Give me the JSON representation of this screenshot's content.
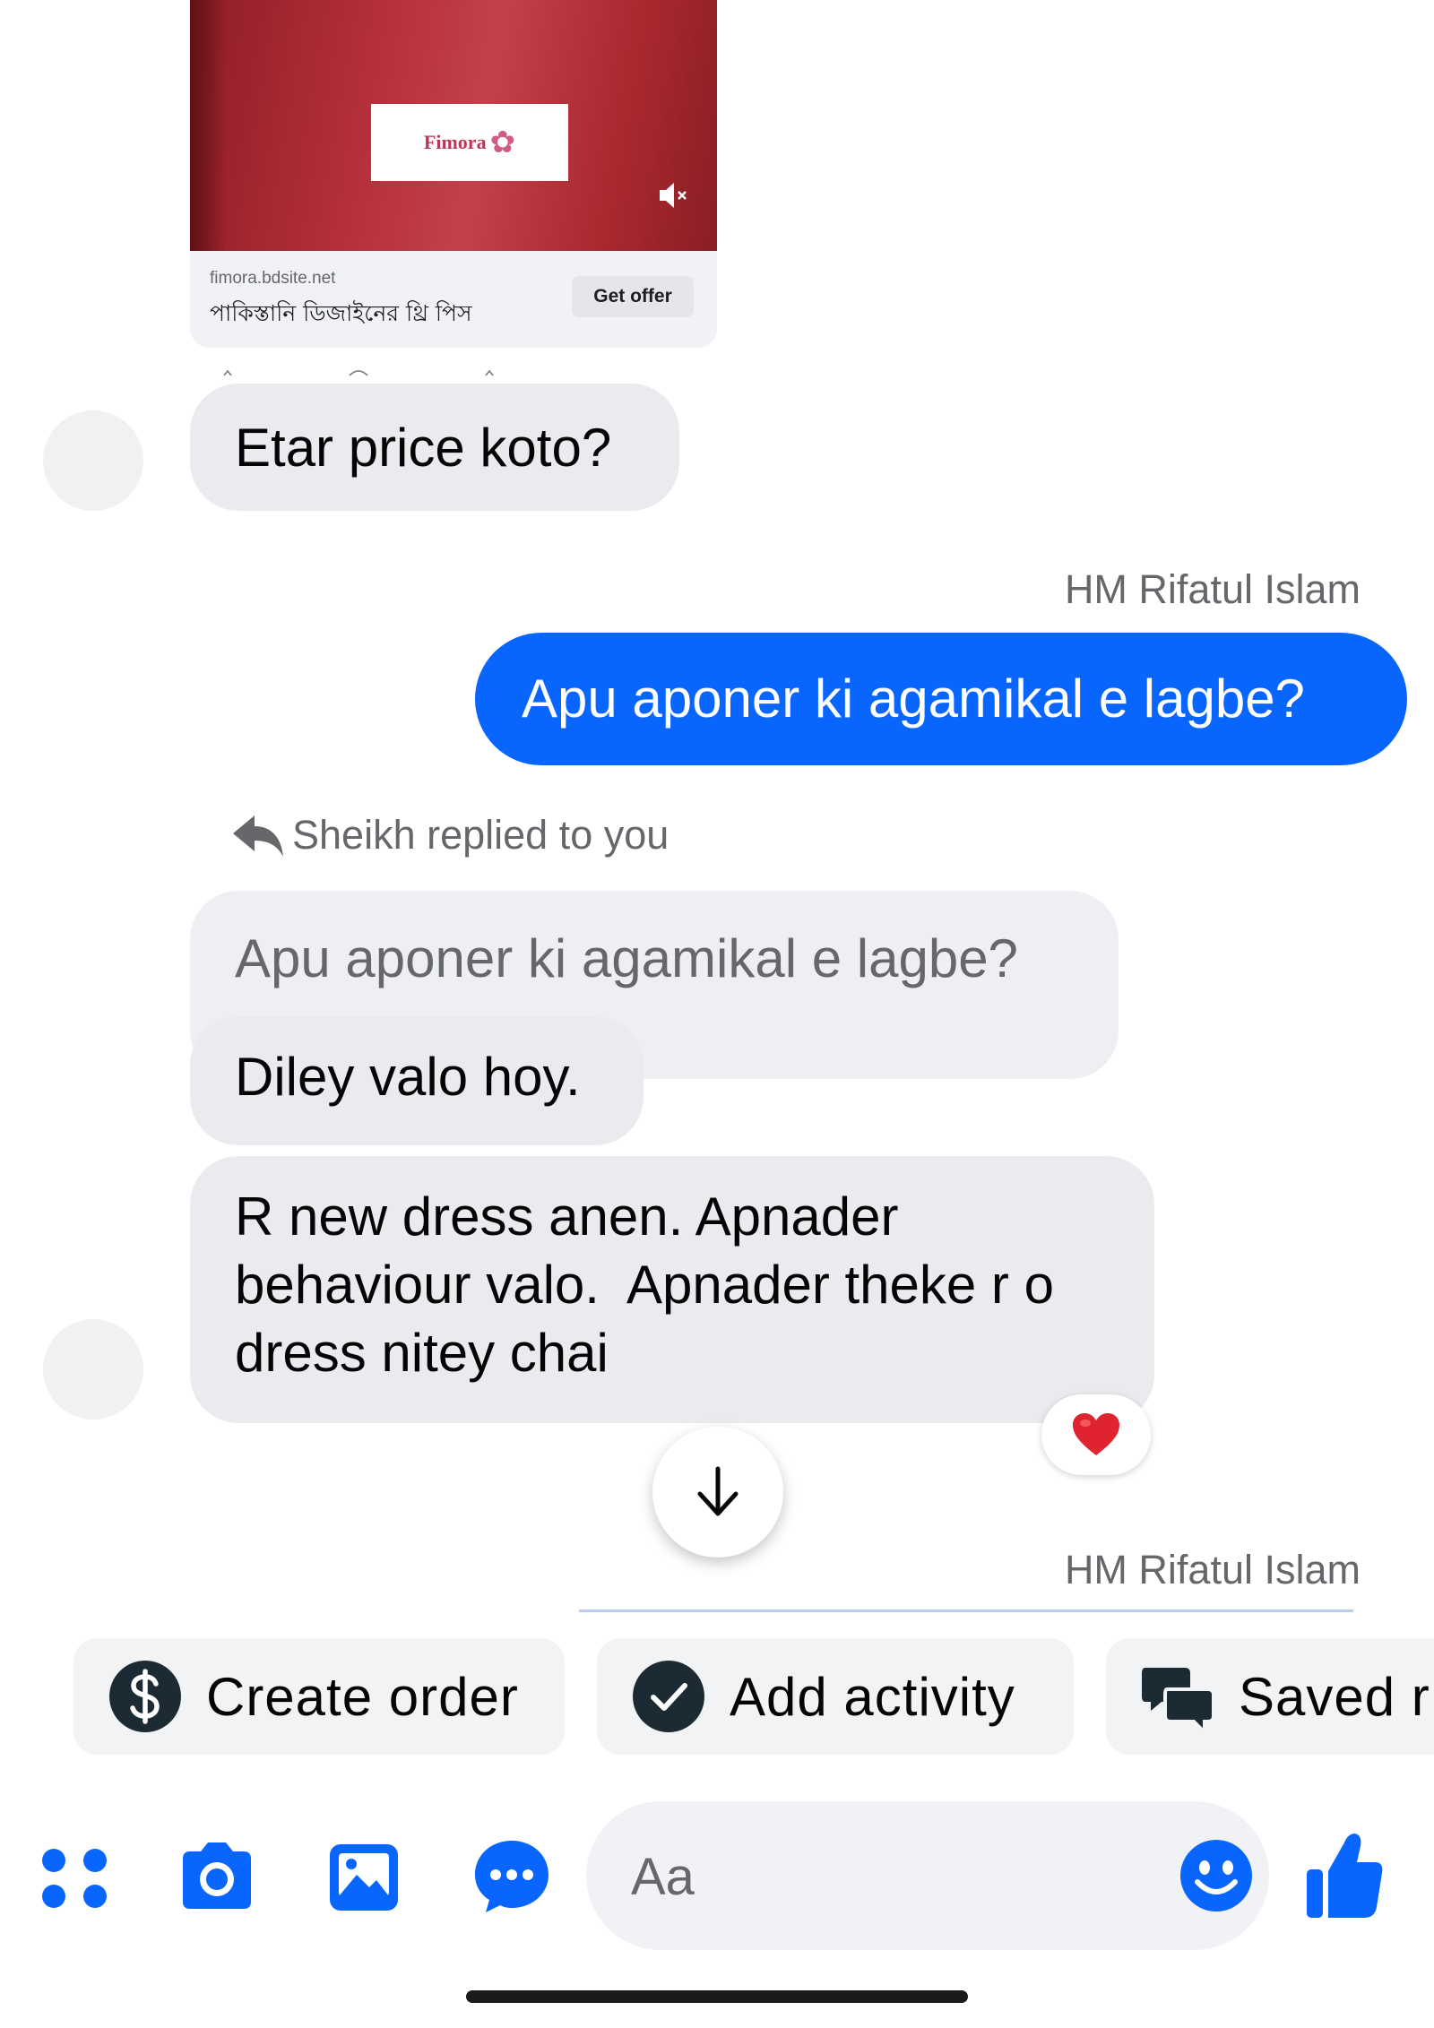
{
  "ad": {
    "brand_logo_text": "Fimora",
    "domain": "fimora.bdsite.net",
    "headline": "পাকিস্তানি ডিজাইনের থ্রি পিস",
    "cta_label": "Get offer"
  },
  "messages": [
    {
      "direction": "incoming",
      "text": "Etar price koto?"
    },
    {
      "direction": "outgoing",
      "sender": "HM Rifatul Islam",
      "text": "Apu aponer ki agamikal e lagbe?"
    },
    {
      "direction": "incoming",
      "reply_header": "Sheikh replied to you",
      "quoted": "Apu aponer ki agamikal e lagbe?",
      "text": "Diley valo hoy."
    },
    {
      "direction": "incoming",
      "lines": [
        "R new dress anen. Apnader",
        "behaviour valo.  Apnader theke r o",
        "dress nitey chai"
      ],
      "reaction": "heart"
    }
  ],
  "next_sender": "HM Rifatul Islam",
  "quick_actions": [
    {
      "label": "Create order",
      "icon": "dollar-circle-icon"
    },
    {
      "label": "Add activity",
      "icon": "check-circle-icon"
    },
    {
      "label": "Saved r",
      "icon": "chat-bubbles-icon"
    }
  ],
  "composer": {
    "placeholder": "Aa",
    "tools": [
      "apps-grid-icon",
      "camera-icon",
      "photo-icon",
      "chat-dots-icon"
    ],
    "emoji_icon": "smiley-icon",
    "send_icon": "thumbs-up-icon"
  },
  "colors": {
    "accent": "#0866ff",
    "incoming_bubble": "#e9ebef",
    "reaction_heart": "#e0242f"
  }
}
